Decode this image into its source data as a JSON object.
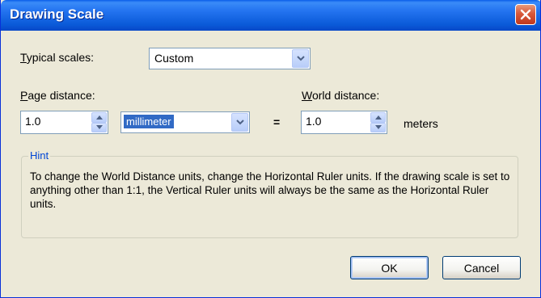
{
  "window": {
    "title": "Drawing Scale"
  },
  "typical_scales": {
    "label": "Typical scales:",
    "value": "Custom"
  },
  "page_distance": {
    "label": "Page distance:",
    "value": "1.0",
    "unit": "millimeter"
  },
  "equals_sign": "=",
  "world_distance": {
    "label": "World distance:",
    "value": "1.0",
    "unit": "meters"
  },
  "hint": {
    "title": "Hint",
    "text": "To change the World Distance units, change the Horizontal Ruler units.  If the drawing scale is set to anything other than 1:1, the Vertical Ruler units will always be the same as the Horizontal Ruler units."
  },
  "buttons": {
    "ok": "OK",
    "cancel": "Cancel"
  },
  "colors": {
    "titlebar": "#0a5ad8",
    "accent": "#316ac5",
    "hint_title": "#0046d5",
    "close": "#d8583a"
  },
  "icons": [
    "close-icon",
    "chevron-down-icon",
    "spin-up-icon",
    "spin-down-icon"
  ]
}
